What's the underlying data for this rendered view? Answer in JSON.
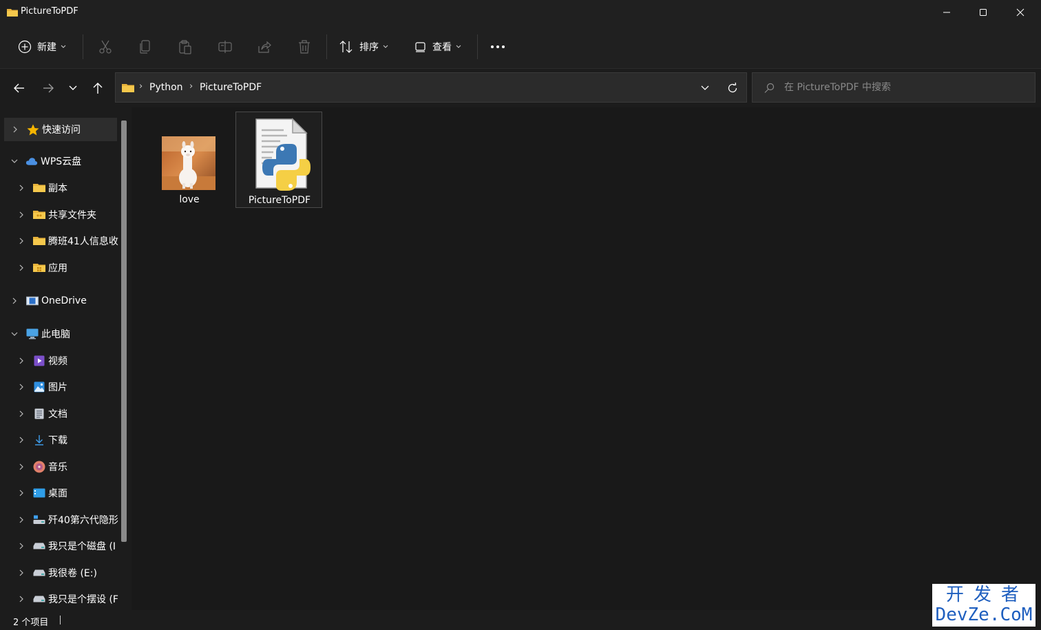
{
  "window": {
    "title": "PictureToPDF"
  },
  "commandbar": {
    "new_label": "新建",
    "sort_label": "排序",
    "view_label": "查看"
  },
  "address": {
    "crumbs": [
      "Python",
      "PictureToPDF"
    ]
  },
  "search": {
    "placeholder": "在 PictureToPDF 中搜索"
  },
  "sidebar": {
    "items": [
      {
        "label": "快速访问",
        "icon": "star-icon"
      },
      {
        "label": "WPS云盘",
        "icon": "cloud-icon"
      },
      {
        "label": "副本",
        "icon": "folder-icon"
      },
      {
        "label": "共享文件夹",
        "icon": "folder-icon"
      },
      {
        "label": "腾班41人信息收",
        "icon": "folder-icon"
      },
      {
        "label": "应用",
        "icon": "folder-icon"
      },
      {
        "label": "OneDrive",
        "icon": "onedrive-icon"
      },
      {
        "label": "此电脑",
        "icon": "computer-icon"
      },
      {
        "label": "视频",
        "icon": "video-icon"
      },
      {
        "label": "图片",
        "icon": "pictures-icon"
      },
      {
        "label": "文档",
        "icon": "documents-icon"
      },
      {
        "label": "下载",
        "icon": "download-icon"
      },
      {
        "label": "音乐",
        "icon": "music-icon"
      },
      {
        "label": "桌面",
        "icon": "desktop-icon"
      },
      {
        "label": "歼40第六代隐形",
        "icon": "drive-icon"
      },
      {
        "label": "我只是个磁盘 (I",
        "icon": "drive-icon"
      },
      {
        "label": "我很卷 (E:)",
        "icon": "drive-icon"
      },
      {
        "label": "我只是个摆设 (F",
        "icon": "drive-icon"
      }
    ]
  },
  "files": [
    {
      "name": "love",
      "type": "image"
    },
    {
      "name": "PictureToPDF",
      "type": "python"
    }
  ],
  "status": {
    "count_text": "2 个项目"
  },
  "watermark": {
    "line1": "开发者",
    "line2": "DevZe.CoM"
  },
  "colors": {
    "background": "#191919",
    "panel": "#202020",
    "accent_blue": "#1f5fbf"
  }
}
